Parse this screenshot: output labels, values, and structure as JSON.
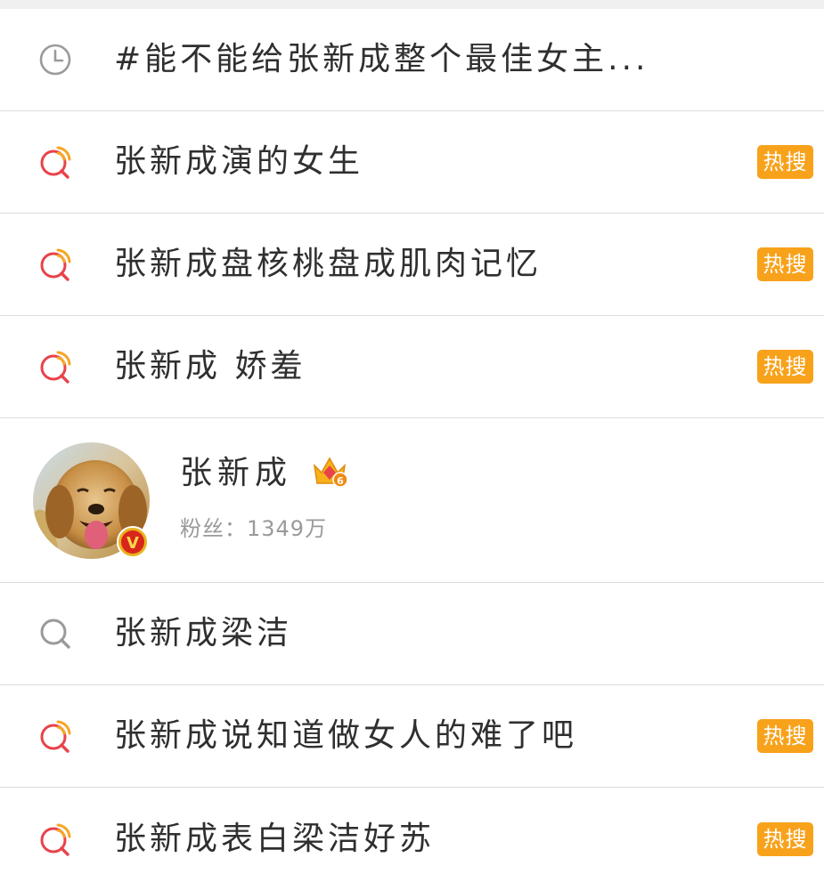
{
  "history": {
    "text": "#能不能给张新成整个最佳女主..."
  },
  "suggestions_top": [
    {
      "text": "张新成演的女生",
      "badge": "热搜",
      "icon": "hot-search-icon"
    },
    {
      "text": "张新成盘核桃盘成肌肉记忆",
      "badge": "热搜",
      "icon": "hot-search-icon"
    },
    {
      "text": "张新成 娇羞",
      "badge": "热搜",
      "icon": "hot-search-icon"
    }
  ],
  "user": {
    "name": "张新成",
    "fans_label": "粉丝：",
    "fans_count": "1349万",
    "verified": "V",
    "level": "6"
  },
  "suggestions_bottom": [
    {
      "text": "张新成梁洁",
      "badge": "",
      "icon": "search-icon"
    },
    {
      "text": "张新成说知道做女人的难了吧",
      "badge": "热搜",
      "icon": "hot-search-icon"
    },
    {
      "text": "张新成表白梁洁好苏",
      "badge": "热搜",
      "icon": "hot-search-icon"
    }
  ],
  "colors": {
    "badge": "#f8a21b",
    "hot_icon_red": "#e8434a",
    "hot_icon_orange": "#f6a623",
    "gray_icon": "#9a9a9a"
  }
}
